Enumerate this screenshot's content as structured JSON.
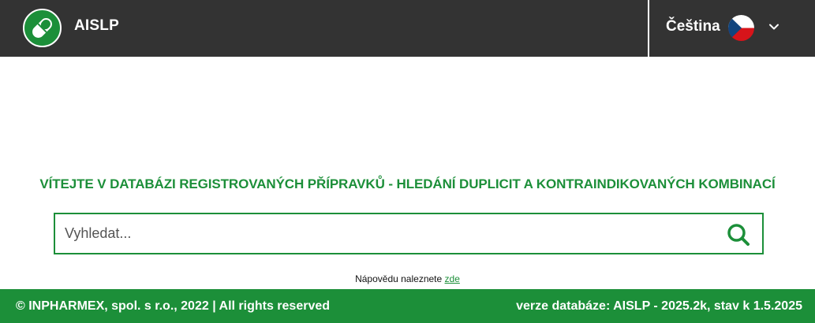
{
  "header": {
    "logo_icon": "pill-icon",
    "app_title": "AISLP",
    "language": {
      "label": "Čeština",
      "flag_icon": "czech-flag-icon",
      "dropdown_icon": "chevron-down-icon"
    }
  },
  "main": {
    "welcome_text": "VÍTEJTE V DATABÁZI REGISTROVANÝCH PŘÍPRAVKŮ - HLEDÁNÍ DUPLICIT A KONTRAINDIKOVANÝCH KOMBINACÍ",
    "search": {
      "placeholder": "Vyhledat...",
      "value": "",
      "button_icon": "search-icon"
    },
    "help": {
      "text": "Nápovědu naleznete",
      "link_label": "zde"
    }
  },
  "footer": {
    "copyright": "© INPHARMEX, spol. s r.o., 2022 | All rights reserved",
    "version": "verze databáze: AISLP - 2025.2k, stav k 1.5.2025"
  },
  "colors": {
    "header_bg": "#333333",
    "brand_green": "#1c8f39",
    "text_light": "#ffffff"
  }
}
